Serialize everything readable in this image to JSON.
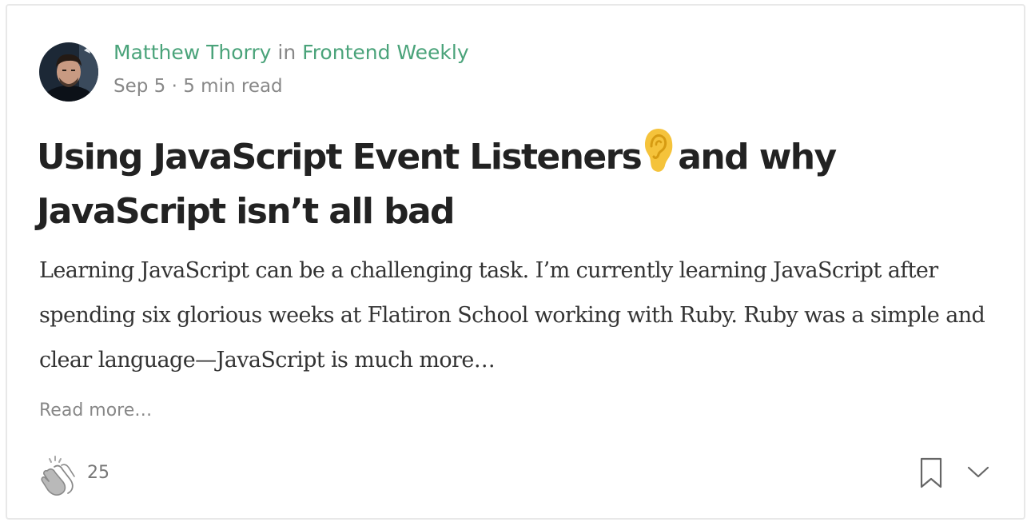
{
  "author": {
    "name": "Matthew Thorry",
    "in_word": "in",
    "publication": "Frontend Weekly"
  },
  "meta": {
    "date": "Sep 5",
    "separator": "·",
    "read_time": "5 min read"
  },
  "post": {
    "title_part1": "Using JavaScript Event Listeners",
    "title_emoji_icon": "ear-icon",
    "title_part2": "and why JavaScript isn’t all bad",
    "excerpt": "Learning JavaScript can be a challenging task. I’m currently learning JavaScript after spending six glorious weeks at Flatiron School working with Ruby. Ruby was a simple and clear language—JavaScript is much more…",
    "read_more": "Read more…"
  },
  "footer": {
    "clap_icon": "clap-icon",
    "clap_count": "25",
    "bookmark_icon": "bookmark-icon",
    "more_icon": "chevron-down-icon"
  },
  "colors": {
    "accent": "#4aa37a",
    "muted": "#888888",
    "title": "#222222",
    "body": "#333333"
  }
}
